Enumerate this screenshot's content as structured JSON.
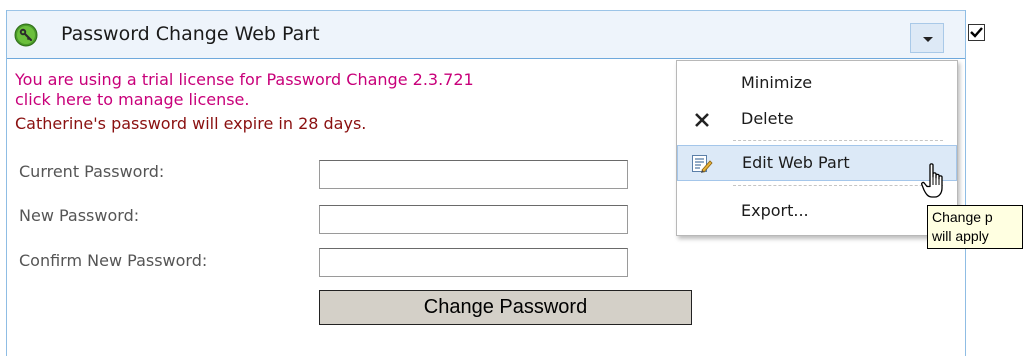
{
  "webpart": {
    "title": "Password Change Web Part",
    "title_icon": "key-icon",
    "menu_button_icon": "chevron-down-icon",
    "checkbox_checked": true
  },
  "messages": {
    "trial_notice": "You are using a trial license for Password Change 2.3.721",
    "manage_license_link": "click here to manage license.",
    "expiry_notice": "Catherine's password will expire in 28 days."
  },
  "form": {
    "current_password_label": "Current Password:",
    "current_password_value": "",
    "new_password_label": "New Password:",
    "new_password_value": "",
    "confirm_password_label": "Confirm New Password:",
    "confirm_password_value": "",
    "submit_label": "Change Password"
  },
  "menu": {
    "items": [
      {
        "label": "Minimize",
        "icon": ""
      },
      {
        "label": "Delete",
        "icon": "close-icon"
      },
      {
        "label": "Edit Web Part",
        "icon": "edit-icon",
        "hovered": true
      },
      {
        "label": "Export...",
        "icon": ""
      }
    ]
  },
  "tooltip": {
    "line1": "Change p",
    "line2": "will apply"
  },
  "colors": {
    "trial_text": "#c8007a",
    "expiry_text": "#8a1010",
    "header_bg": "#eef4fb",
    "border_blue": "#8fbde4",
    "button_bg": "#d4d0c8",
    "tooltip_bg": "#ffffe1",
    "menu_hover_bg": "#dce9f7"
  }
}
